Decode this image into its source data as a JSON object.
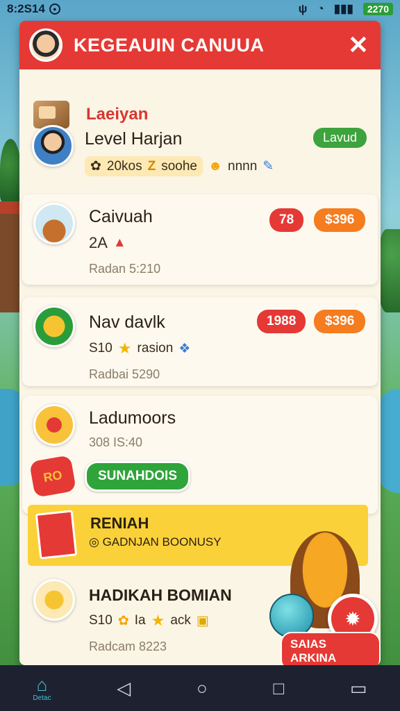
{
  "status_bar": {
    "time": "8:2S14",
    "battery": "2270"
  },
  "dialog": {
    "title": "KEGEAUIN CANUUA",
    "close_label": "✕",
    "section_title": "Laeiyan"
  },
  "level_row": {
    "title": "Level Harjan",
    "badge": "Lavud",
    "pill_left": "20kos",
    "pill_mid": "Z",
    "pill_text": "soohe",
    "trailing": "nnnn"
  },
  "cards": [
    {
      "title": "Caivuah",
      "line": "2A",
      "sub": "Radan  5:210",
      "badge_red": "78",
      "badge_orange": "$396"
    },
    {
      "title": "Nav davlk",
      "line_value": "S10",
      "line_text": "rasion",
      "sub": "Radbai  5290",
      "badge_red": "1988",
      "badge_orange": "$396"
    },
    {
      "title": "Ladumoors",
      "line": "308   IS:40",
      "bag_text": "RO",
      "button": "SUNAHDOIS"
    }
  ],
  "promo": {
    "title": "RENIAH",
    "sub": "GADNJAN BOONUSY"
  },
  "bottom_row": {
    "title": "HADIKAH BOMIAN",
    "line_value": "S10",
    "line_mid": "Ia",
    "line_text": "ack",
    "sub": "Radcam  8223"
  },
  "prize": {
    "label": "SAIAS ARKINA"
  },
  "nav": {
    "home_label": "Detac"
  }
}
